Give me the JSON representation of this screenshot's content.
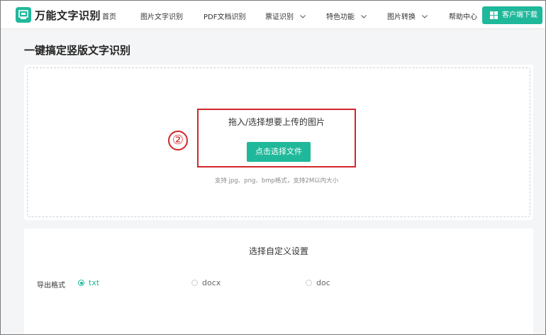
{
  "nav": {
    "brand": "万能文字识别",
    "items": [
      "首页",
      "图片文字识别",
      "PDF文档识别",
      "票证识别",
      "特色功能",
      "图片转换",
      "帮助中心"
    ],
    "download_label": "客户端下载",
    "accent": "#1fb89a"
  },
  "page": {
    "title": "一键搞定竖版文字识别"
  },
  "upload": {
    "prompt": "拖入/选择想要上传的图片",
    "button_label": "点击选择文件",
    "hint": "支持 jpg、png、bmp格式，支持2M以内大小",
    "annotation_number": "②",
    "annotation_color": "#d2272b"
  },
  "settings": {
    "title": "选择自定义设置",
    "export_label": "导出格式",
    "formats": [
      {
        "label": "txt",
        "selected": true
      },
      {
        "label": "docx",
        "selected": false
      },
      {
        "label": "doc",
        "selected": false
      }
    ]
  }
}
